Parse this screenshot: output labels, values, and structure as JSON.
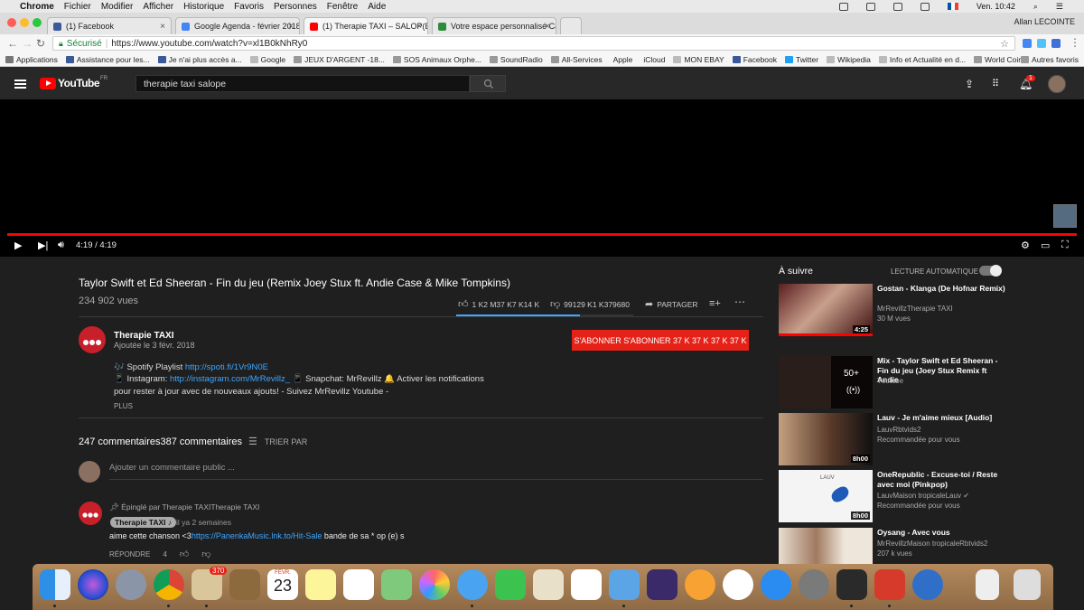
{
  "mac_menu": {
    "apple": "",
    "app": "Chrome",
    "items": [
      "Fichier",
      "Modifier",
      "Afficher",
      "Historique",
      "Favoris",
      "Personnes",
      "Fenêtre",
      "Aide"
    ],
    "clock": "Ven. 10:42"
  },
  "browser": {
    "tabs": [
      {
        "label": "(1) Facebook",
        "color": "#3b5998"
      },
      {
        "label": "Google Agenda - février 2018",
        "color": "#4285f4"
      },
      {
        "label": "(1) Therapie TAXI – SALOP(E)",
        "color": "#ff0000"
      },
      {
        "label": "Votre espace personnalisé Ca",
        "color": "#2e8b3a"
      }
    ],
    "profile_name": "Allan LECOINTE",
    "secure_label": "Sécurisé",
    "url": "https://www.youtube.com/watch?v=xl1B0kNhRy0",
    "bookmarks": [
      {
        "label": "Applications",
        "color": "#777"
      },
      {
        "label": "Assistance pour les...",
        "color": "#3b5998"
      },
      {
        "label": "Je n'ai plus accès a...",
        "color": "#3b5998"
      },
      {
        "label": "Google",
        "color": "#bbb"
      },
      {
        "label": "JEUX D'ARGENT -18...",
        "color": "#999"
      },
      {
        "label": "SOS Animaux Orphe...",
        "color": "#999"
      },
      {
        "label": "SoundRadio",
        "color": "#999"
      },
      {
        "label": "All-Services",
        "color": "#999"
      },
      {
        "label": "Apple",
        "color": "#222"
      },
      {
        "label": "iCloud",
        "color": "#222"
      },
      {
        "label": "MON EBAY",
        "color": "#bbb"
      },
      {
        "label": "Facebook",
        "color": "#3b5998"
      },
      {
        "label": "Twitter",
        "color": "#1da1f2"
      },
      {
        "label": "Wikipedia",
        "color": "#bbb"
      },
      {
        "label": "Info et Actualité en d...",
        "color": "#bbb"
      },
      {
        "label": "World Coin",
        "color": "#999"
      }
    ],
    "other_bookmarks": "Autres favoris"
  },
  "youtube": {
    "logo_text": "YouTube",
    "region": "FR",
    "search_value": "therapie taxi salope",
    "notification_count": "1"
  },
  "player": {
    "time": "4:19 / 4:19",
    "progress": 1.0
  },
  "video": {
    "title": "Taylor Swift et Ed Sheeran - Fin du jeu (Remix Joey Stux ft. Andie Case & Mike Tompkins)",
    "views": "234 902 vues",
    "likes": "1 K2 M37 K7 K14 K",
    "dislikes": "99129 K1 K379680",
    "share_label": "PARTAGER",
    "like_ratio": 0.7
  },
  "channel": {
    "name": "Therapie TAXI",
    "date": "Ajoutée le 3 févr. 2018",
    "subscribe_label": "S'ABONNER S'ABONNER 37 K 37 K 37 K 37 K"
  },
  "description": {
    "line1_prefix": "🎶 Spotify Playlist ",
    "line1_link": "http://spoti.fi/1Vr9N0E",
    "line2_prefix": "📱 Instagram: ",
    "line2_link": "http://instagram.com/MrRevillz_",
    "line2_suffix": " 📱 Snapchat: MrRevillz 🔔 Activer les notifications",
    "line3": "pour rester à jour avec de nouveaux ajouts! - Suivez MrRevillz Youtube -",
    "more_label": "PLUS"
  },
  "comments": {
    "count_label": "247 commentaires387 commentaires",
    "sort_label": "TRIER PAR",
    "input_placeholder": "Ajouter un commentaire public ...",
    "pinned_label": "Épinglé par Therapie TAXITherapie TAXI",
    "author": "Therapie TAXI ♪",
    "time": "il ya 2 semaines",
    "text_prefix": "aime cette chanson <3",
    "text_link": "https://PanenkaMusic.lnk.to/Hit-Sale",
    "text_suffix": " bande de sa * op (e) s",
    "reply_label": "RÉPONDRE",
    "like_count": "4"
  },
  "sidebar": {
    "up_next": "À suivre",
    "autoplay": "LECTURE AUTOMATIQUE",
    "items": [
      {
        "title": "Gostan - Klanga (De Hofnar Remix)",
        "channel": "MrRevillzTherapie TAXI",
        "meta": "30 M vues",
        "duration": "4:25"
      },
      {
        "title": "Mix - Taylor Swift et Ed Sheeran - Fin du jeu (Joey Stux Remix ft Andie",
        "channel": "Youtube",
        "meta": "",
        "duration": "50+"
      },
      {
        "title": "Lauv - Je m'aime mieux [Audio]",
        "channel": "LauvRbtvids2",
        "meta": "Recommandée pour vous",
        "duration": "8h00"
      },
      {
        "title": "OneRepublic - Excuse-toi / Reste avec moi (Pinkpop)",
        "channel": "LauvMaison tropicaleLauv",
        "meta": "Recommandée pour vous",
        "duration": "8h00"
      },
      {
        "title": "Oysang - Avec vous",
        "channel": "MrRevillzMaison tropicaleRbtvids2",
        "meta": "207 k vues",
        "duration": ""
      }
    ]
  },
  "dock": {
    "calendar_month": "FÉVR.",
    "calendar_day": "23",
    "mail_badge": "370"
  }
}
